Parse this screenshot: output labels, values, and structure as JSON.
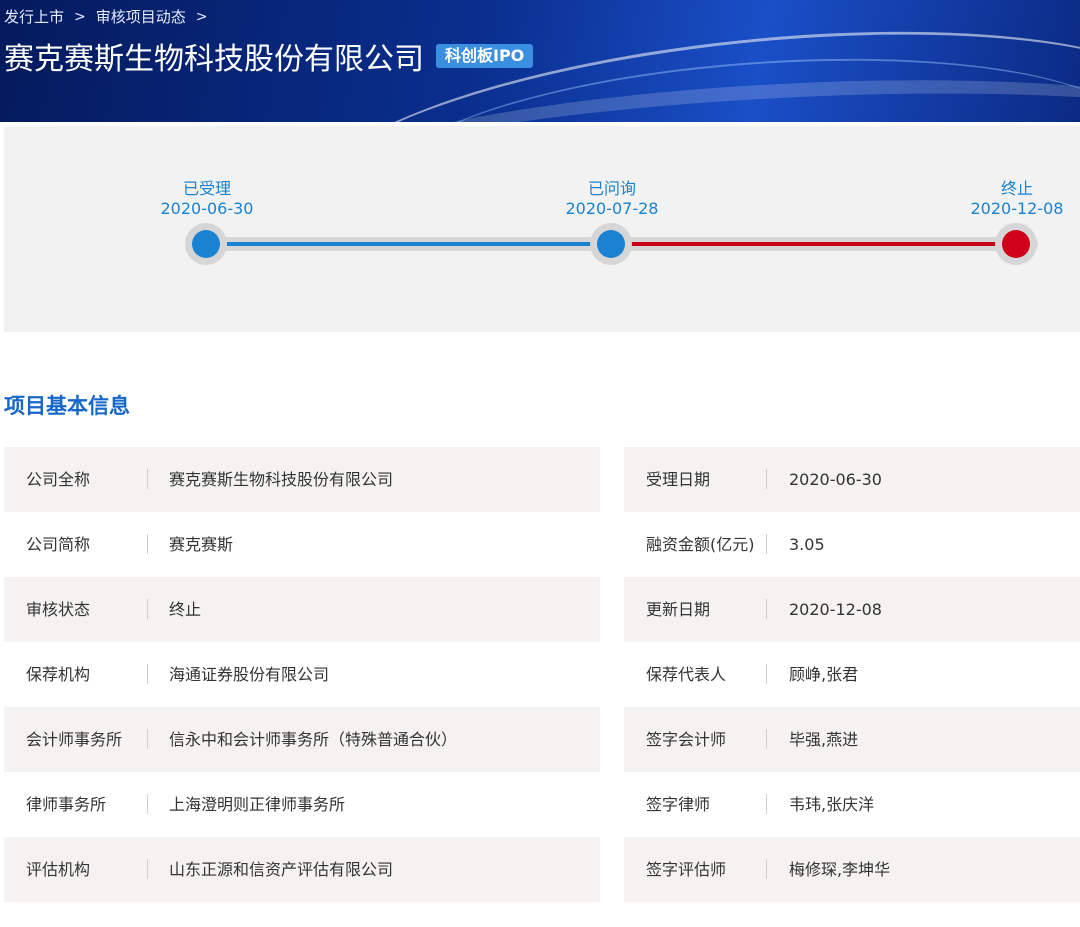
{
  "breadcrumb": [
    "发行上市",
    "审核项目动态"
  ],
  "header": {
    "company_name": "赛克赛斯生物科技股份有限公司",
    "board_tag": "科创板IPO"
  },
  "timeline": {
    "stages": [
      {
        "label": "已受理",
        "date": "2020-06-30",
        "color": "#1a82d0"
      },
      {
        "label": "已问询",
        "date": "2020-07-28",
        "color": "#1a82d0"
      },
      {
        "label": "终止",
        "date": "2020-12-08",
        "color": "#d0021b"
      }
    ],
    "segment_colors": [
      "#1a82d0",
      "#c8001a"
    ]
  },
  "section_title": "项目基本信息",
  "info_left": [
    {
      "label": "公司全称",
      "value": "赛克赛斯生物科技股份有限公司"
    },
    {
      "label": "公司简称",
      "value": "赛克赛斯"
    },
    {
      "label": "审核状态",
      "value": "终止"
    },
    {
      "label": "保荐机构",
      "value": "海通证券股份有限公司"
    },
    {
      "label": "会计师事务所",
      "value": "信永中和会计师事务所（特殊普通合伙）"
    },
    {
      "label": "律师事务所",
      "value": "上海澄明则正律师事务所"
    },
    {
      "label": "评估机构",
      "value": "山东正源和信资产评估有限公司"
    }
  ],
  "info_right": [
    {
      "label": "受理日期",
      "value": "2020-06-30"
    },
    {
      "label": "融资金额(亿元)",
      "value": "3.05"
    },
    {
      "label": "更新日期",
      "value": "2020-12-08"
    },
    {
      "label": "保荐代表人",
      "value": "顾峥,张君"
    },
    {
      "label": "签字会计师",
      "value": "毕强,燕进"
    },
    {
      "label": "签字律师",
      "value": "韦玮,张庆洋"
    },
    {
      "label": "签字评估师",
      "value": "梅修琛,李坤华"
    }
  ]
}
